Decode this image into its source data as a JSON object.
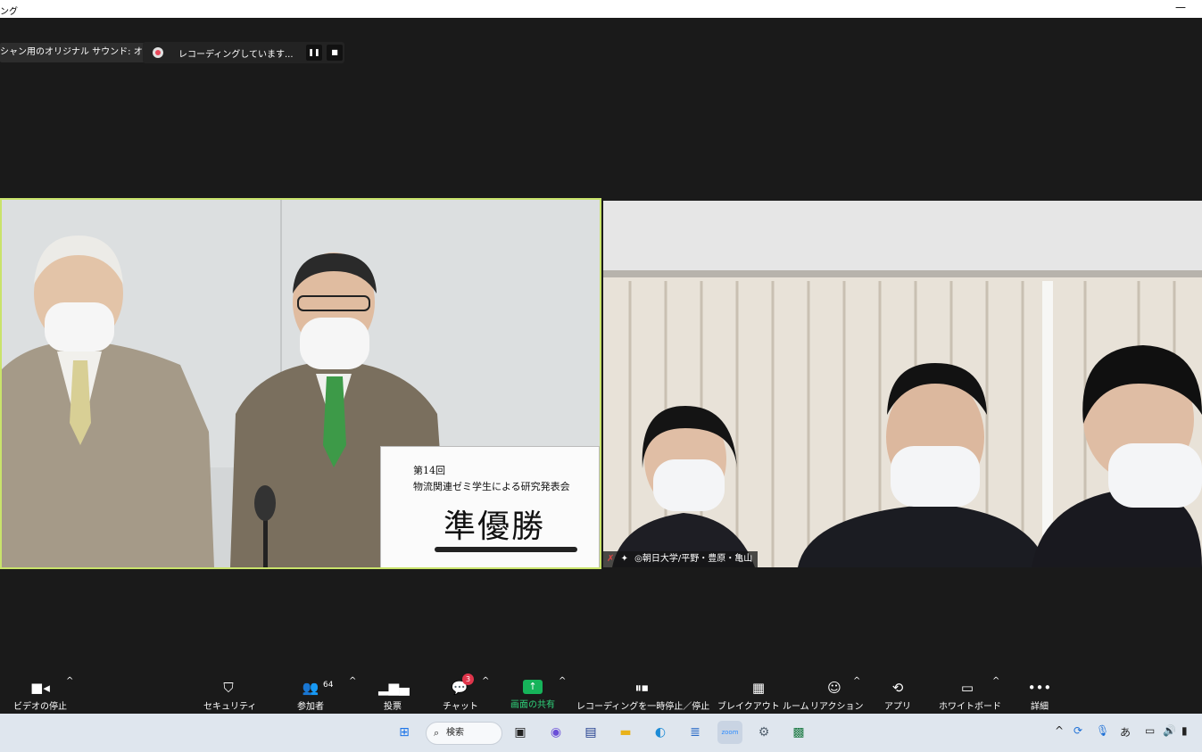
{
  "window": {
    "title": "ング",
    "minimize_glyph": "—"
  },
  "meeting": {
    "audio_label": "シャン用のオリジナル サウンド: オフ",
    "recording_label": "レコーディングしています..."
  },
  "tiles": {
    "sign_line1": "第14回",
    "sign_line2": "物流関連ゼミ学生による研究発表会",
    "sign_line3": "準優勝",
    "participant_name": "◎朝日大学/平野・豊原・亀山"
  },
  "toolbar": {
    "video_label": "ビデオの停止",
    "security_label": "セキュリティ",
    "participants_label": "参加者",
    "participants_count": "64",
    "polls_label": "投票",
    "chat_label": "チャット",
    "chat_badge": "3",
    "share_label": "画面の共有",
    "record_label": "レコーディングを一時停止／停止",
    "breakout_label": "ブレイクアウト ルーム",
    "reactions_label": "リアクション",
    "apps_label": "アプリ",
    "whiteboard_label": "ホワイトボード",
    "more_label": "詳細"
  },
  "taskbar": {
    "search_label": "検索",
    "ime_label": "あ",
    "zoom_label": "zoom"
  },
  "colors": {
    "active_speaker_border": "#c9e36b",
    "share_green": "#16b35a",
    "badge_red": "#e0354b",
    "taskbar_bg": "#dfe6ee"
  }
}
